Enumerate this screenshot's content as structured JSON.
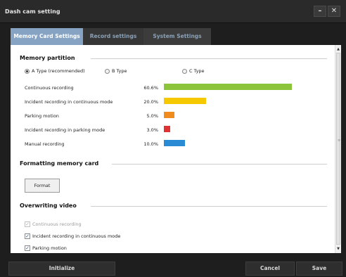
{
  "window": {
    "title": "Dash cam setting",
    "minimize_icon": "minimize-icon",
    "close_icon": "close-icon"
  },
  "tabs": [
    {
      "label": "Memory Card Settings",
      "active": true
    },
    {
      "label": "Record settings",
      "active": false
    },
    {
      "label": "System Settings",
      "active": false
    }
  ],
  "memory_partition": {
    "heading": "Memory partition",
    "options": [
      {
        "label": "A Type (recommended)",
        "selected": true
      },
      {
        "label": "B Type",
        "selected": false
      },
      {
        "label": "C Type",
        "selected": false
      }
    ],
    "rows": [
      {
        "label": "Continuous recording",
        "percent_text": "60.6%",
        "percent": 60.6,
        "color": "#8cc43c"
      },
      {
        "label": "Incident recording in continuous mode",
        "percent_text": "20.0%",
        "percent": 20.0,
        "color": "#f5c800"
      },
      {
        "label": "Parking motion",
        "percent_text": "5.0%",
        "percent": 5.0,
        "color": "#f08c1e"
      },
      {
        "label": "Incident recording in parking mode",
        "percent_text": "3.0%",
        "percent": 3.0,
        "color": "#e03232"
      },
      {
        "label": "Manual recording",
        "percent_text": "10.0%",
        "percent": 10.0,
        "color": "#2a8ad4"
      }
    ]
  },
  "formatting": {
    "heading": "Formatting memory card",
    "button_label": "Format"
  },
  "overwriting": {
    "heading": "Overwriting video",
    "items": [
      {
        "label": "Continuous recording",
        "checked": true,
        "disabled": true
      },
      {
        "label": "Incident recording in continuous mode",
        "checked": true,
        "disabled": false
      },
      {
        "label": "Parking motion",
        "checked": true,
        "disabled": false
      }
    ]
  },
  "footer": {
    "initialize_label": "Initialize",
    "cancel_label": "Cancel",
    "save_label": "Save"
  },
  "colors": {
    "active_tab": "#86a3c3",
    "dark_chrome": "#1e1e1e"
  }
}
